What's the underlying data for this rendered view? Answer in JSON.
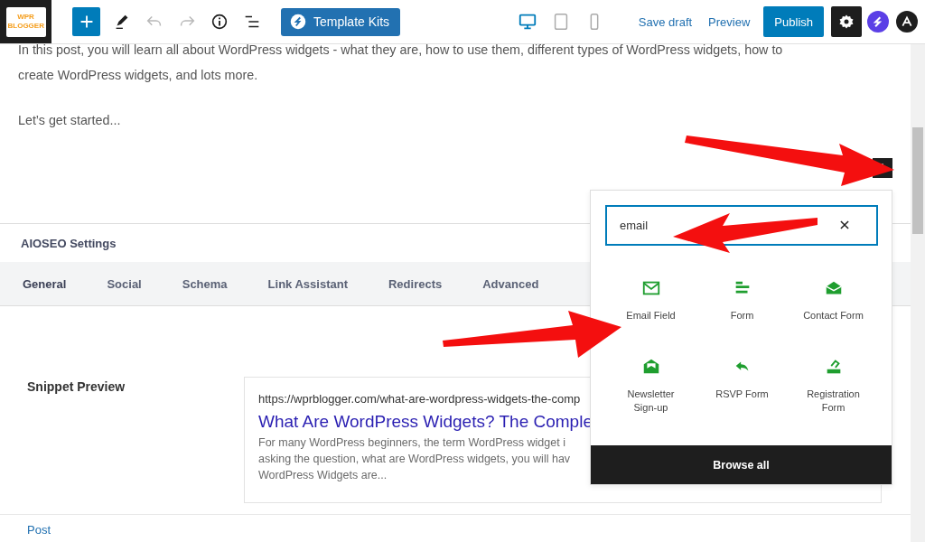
{
  "top_bar": {
    "logo_text": "WPR BLOGGER",
    "tools": [
      {
        "kind": "add",
        "disabled": false
      },
      {
        "kind": "pen",
        "disabled": false
      },
      {
        "kind": "undo",
        "disabled": true
      },
      {
        "kind": "redo",
        "disabled": true
      },
      {
        "kind": "info",
        "disabled": false
      },
      {
        "kind": "outline",
        "disabled": false
      }
    ],
    "template_kits_button": "Template Kits",
    "device_previews": [
      {
        "kind": "desktop",
        "selected": true
      },
      {
        "kind": "tablet",
        "selected": false
      },
      {
        "kind": "mobile",
        "selected": false
      }
    ],
    "save_draft": "Save draft",
    "preview": "Preview",
    "publish": "Publish"
  },
  "content": {
    "paragraphs": [
      "In this post, you will learn all about WordPress widgets - what they are, how to use them, different types of WordPress widgets, how to create WordPress widgets, and lots more.",
      "Let’s get started..."
    ]
  },
  "aioseo": {
    "title": "AIOSEO Settings",
    "tabs": [
      {
        "label": "General",
        "selected": true
      },
      {
        "label": "Social",
        "selected": false
      },
      {
        "label": "Schema",
        "selected": false
      },
      {
        "label": "Link Assistant",
        "selected": false
      },
      {
        "label": "Redirects",
        "selected": false
      },
      {
        "label": "Advanced",
        "selected": false
      }
    ],
    "snippet_label": "Snippet Preview",
    "snippet": {
      "url": "https://wprblogger.com/what-are-wordpress-widgets-the-comp",
      "title": "What Are WordPress Widgets? The Comple",
      "description_lines": [
        "For many WordPress beginners, the term WordPress widget i",
        "asking the question, what are WordPress widgets, you will hav",
        "WordPress Widgets are..."
      ]
    }
  },
  "inserter": {
    "search": {
      "value": "email"
    },
    "blocks": [
      {
        "kind": "email",
        "label": "Email Field"
      },
      {
        "kind": "form",
        "label": "Form"
      },
      {
        "kind": "contact",
        "label": "Contact Form"
      },
      {
        "kind": "newsletter",
        "label": "Newsletter Sign-up"
      },
      {
        "kind": "rsvp",
        "label": "RSVP Form"
      },
      {
        "kind": "registration",
        "label": "Registration Form"
      }
    ],
    "browse_all": "Browse all"
  },
  "footer": {
    "breadcrumb": "Post"
  }
}
